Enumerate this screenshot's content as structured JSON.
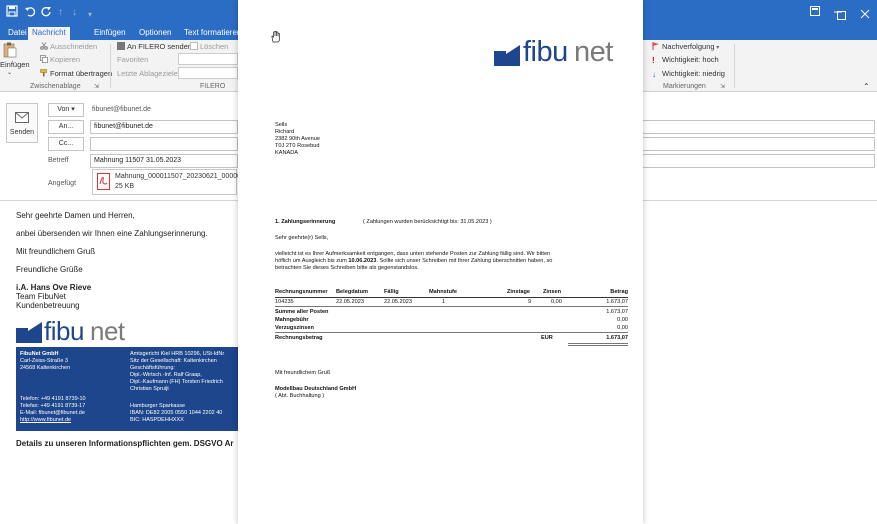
{
  "window": {
    "tabs": [
      "Datei",
      "Nachricht",
      "Einfügen",
      "Optionen",
      "Text formatieren"
    ],
    "active_tab": "Nachricht"
  },
  "ribbon": {
    "paste_label": "Einfügen",
    "cut_label": "Ausschneiden",
    "copy_label": "Kopieren",
    "format_painter_label": "Format übertragen",
    "clipboard_group": "Zwischenablage",
    "filero_send_label": "An FILERO senden",
    "delete_label": "Löschen",
    "favorites_label": "Favoriten",
    "recent_label": "Letzte Ablageziele",
    "filero_group": "FILERO",
    "followup_label": "Nachverfolgung",
    "high_importance_label": "Wichtigkeit: hoch",
    "low_importance_label": "Wichtigkeit: niedrig",
    "tags_group": "Markierungen"
  },
  "header": {
    "send_label": "Senden",
    "from_label": "Von",
    "from_value": "fibunet@fibunet.de",
    "to_label": "An...",
    "to_value": "fibunet@fibunet.de",
    "cc_label": "Cc...",
    "subject_label": "Betreff",
    "subject_value": "Mahnung 11507 31.05.2023",
    "attached_label": "Angefügt",
    "attachment_name": "Mahnung_000011507_20230621_000001.",
    "attachment_size": "25 KB"
  },
  "body": {
    "greeting": "Sehr geehrte Damen und Herren,",
    "line1": "anbei übersenden wir Ihnen eine Zahlungserinnerung.",
    "closing1": "Mit freundlichem Gruß",
    "closing2": "Freundliche Grüße",
    "sig_name": "i.A. Hans Ove Rieve",
    "sig_team": "Team FibuNet",
    "sig_dept": "Kundenbetreuung",
    "footer_left": [
      "FibuNet GmbH",
      "Carl-Zeiss-Straße 3",
      "24568 Kaltenkirchen",
      "",
      "",
      "",
      "",
      "Telefon: +49 4191 8739-10",
      "Telefax: +49 4191 8739-17",
      "E-Mail: fibunet@fibunet.de",
      "http://www.fibunet.de"
    ],
    "footer_right": [
      "Amtsgericht Kiel HRB 10296, USt-IdNr",
      "Sitz der Gesellschaft: Kaltenkirchen",
      "Geschäftsführung:",
      "Dipl.-Wirtsch.-Inf. Ralf Graap,",
      "Dipl.-Kaufmann (FH) Torsten Friedrich",
      "Christian Spruijt",
      "",
      "Hamburger Sparkasse",
      "IBAN: DE82 2005 0550 1044 2202 40",
      "BIC: HASPDEHHXXX"
    ],
    "details": "Details zu unseren Informationspflichten gem. DSGVO Ar"
  },
  "document": {
    "address": [
      "Sells",
      "Richard",
      "2382 90th Avenue",
      "T0J 2T0 Rosebud",
      "KANADA"
    ],
    "title": "1. Zahlungserinnerung",
    "title_note": "( Zahlungen wurden berücksichtigt bis:  31.05.2023  )",
    "salutation": "Sehr geehrte(r)  Sells,",
    "para1": "vielleicht ist es Ihrer Aufmerksamkeit entgangen, dass unten stehende Posten zur Zahlung fällig sind. Wir bitten",
    "para2_pre": "höflich um Ausgleich bis zum  ",
    "para2_date": "10.06.2023",
    "para2_post": ". Sollte sich unser Schreiben mit Ihrer Zahlung überschnitten haben, so",
    "para3": "betrachten Sie dieses Schreiben bitte als gegenstandslos.",
    "table_headers": [
      "Rechnungsnummer",
      "Belegdatum",
      "Fällig",
      "Mahnstufe",
      "Zinstage",
      "Zinsen",
      "Betrag"
    ],
    "row": [
      "104235",
      "22.05.2023",
      "22.05.2023",
      "1",
      "9",
      "0,00",
      "1.673,07"
    ],
    "sum_label": "Summe aller Posten",
    "sum_value": "1.673,07",
    "fee_label": "Mahngebühr",
    "fee_value": "0,00",
    "interest_label": "Verzugszinsen",
    "interest_value": "0,00",
    "total_label": "Rechnungsbetrag",
    "currency": "EUR",
    "total_value": "1.673,07",
    "closing": "Mit freundlichem Gruß",
    "company": "Modellbau Deutschland GmbH",
    "dept": "( Abt. Buchhaltung )"
  },
  "logo": {
    "text_fibu": "fibu",
    "text_net": "net",
    "color": "#1e468c",
    "grey": "#7a7a7a"
  },
  "icons": {
    "save": "save-icon",
    "undo": "undo-icon",
    "redo": "redo-icon",
    "hand": "hand-cursor-icon",
    "flag": "flag-icon"
  }
}
